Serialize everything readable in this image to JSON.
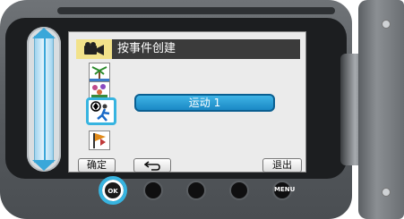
{
  "header": {
    "mode_icon": "camcorder-icon",
    "title": "按事件创建"
  },
  "event_icons": [
    {
      "icon": "palm-tree-icon",
      "name": "vacation"
    },
    {
      "icon": "flowers-icon",
      "name": "holiday"
    },
    {
      "icon": "soccer-player-icon",
      "name": "sports",
      "selected": true
    },
    {
      "icon": "flag-icon",
      "name": "event"
    }
  ],
  "selection": {
    "value": "运动 1"
  },
  "softkeys": {
    "confirm": "确定",
    "back_icon": "return-arrow-icon",
    "exit": "退出"
  },
  "hardware_buttons": {
    "ok_label": "OK",
    "menu_label": "MENU"
  },
  "colors": {
    "highlight": "#37b4e0",
    "selection_bar": "#1a88c5",
    "title_bar": "#3b3b3b",
    "mode_icon_bg": "#f2e28a"
  }
}
